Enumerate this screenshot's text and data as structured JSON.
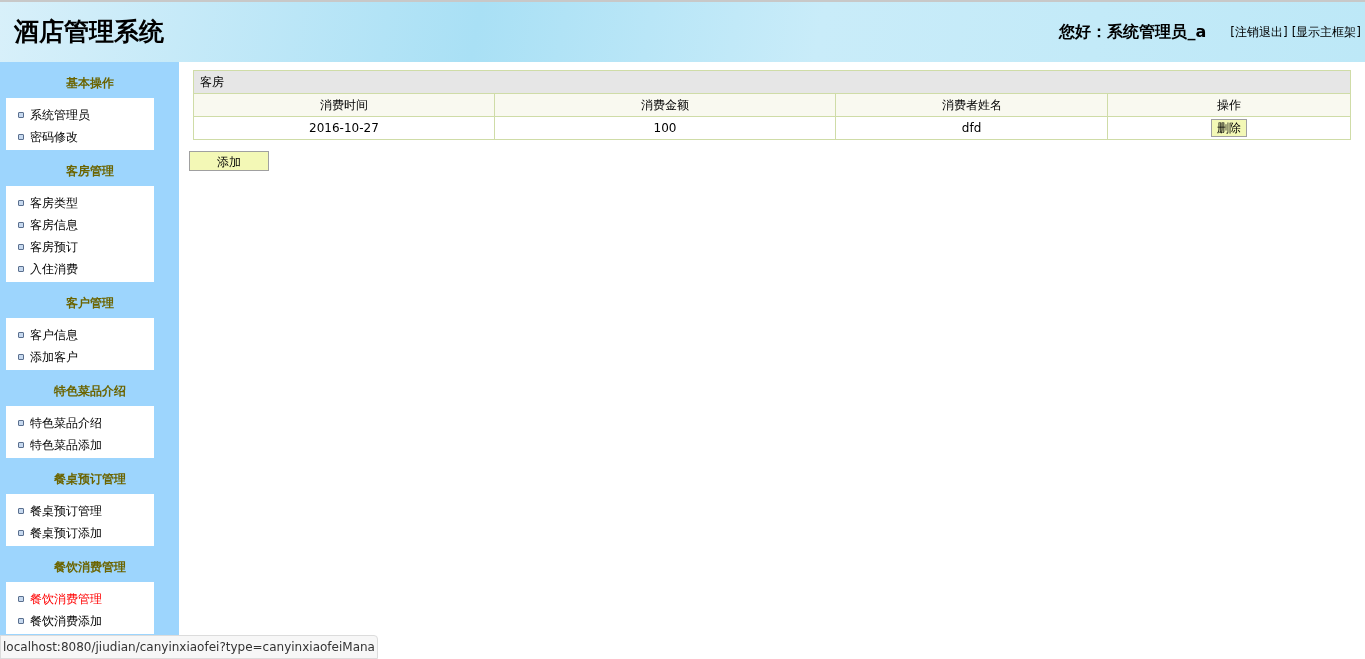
{
  "header": {
    "title": "酒店管理系统",
    "greeting": "您好：系统管理员_a",
    "links": [
      "[注销退出]",
      "[显示主框架]"
    ]
  },
  "sidebar": {
    "sections": [
      {
        "title": "基本操作",
        "items": [
          {
            "label": "系统管理员",
            "selected": false
          },
          {
            "label": "密码修改",
            "selected": false
          }
        ]
      },
      {
        "title": "客房管理",
        "items": [
          {
            "label": "客房类型",
            "selected": false
          },
          {
            "label": "客房信息",
            "selected": false
          },
          {
            "label": "客房预订",
            "selected": false
          },
          {
            "label": "入住消费",
            "selected": false
          }
        ]
      },
      {
        "title": "客户管理",
        "items": [
          {
            "label": "客户信息",
            "selected": false
          },
          {
            "label": "添加客户",
            "selected": false
          }
        ]
      },
      {
        "title": "特色菜品介绍",
        "items": [
          {
            "label": "特色菜品介绍",
            "selected": false
          },
          {
            "label": "特色菜品添加",
            "selected": false
          }
        ]
      },
      {
        "title": "餐桌预订管理",
        "items": [
          {
            "label": "餐桌预订管理",
            "selected": false
          },
          {
            "label": "餐桌预订添加",
            "selected": false
          }
        ]
      },
      {
        "title": "餐饮消费管理",
        "items": [
          {
            "label": "餐饮消费管理",
            "selected": true
          },
          {
            "label": "餐饮消费添加",
            "selected": false
          }
        ]
      }
    ]
  },
  "table": {
    "caption": "客房",
    "columns": [
      "消费时间",
      "消费金额",
      "消费者姓名",
      "操作"
    ],
    "rows": [
      {
        "cells": [
          "2016-10-27",
          "100",
          "dfd"
        ],
        "action": "删除"
      }
    ]
  },
  "add_button": "添加",
  "status_bar": "localhost:8080/jiudian/canyinxiaofei?type=canyinxiaofeiMana"
}
